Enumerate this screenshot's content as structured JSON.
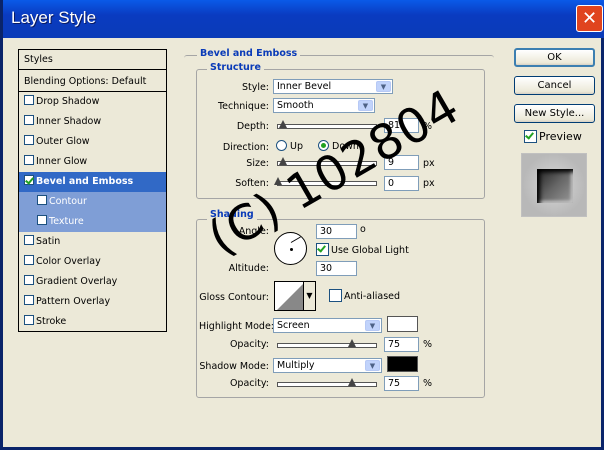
{
  "window": {
    "title": "Layer Style",
    "close_label": "✕"
  },
  "styles_panel": {
    "header": "Styles",
    "items": [
      {
        "label": "Blending Options: Default",
        "checkbox": false
      },
      {
        "label": "Drop Shadow",
        "checkbox": true,
        "checked": false
      },
      {
        "label": "Inner Shadow",
        "checkbox": true,
        "checked": false
      },
      {
        "label": "Outer Glow",
        "checkbox": true,
        "checked": false
      },
      {
        "label": "Inner Glow",
        "checkbox": true,
        "checked": false
      },
      {
        "label": "Bevel and Emboss",
        "checkbox": true,
        "checked": true,
        "selected": true
      },
      {
        "label": "Contour",
        "checkbox": true,
        "checked": false,
        "sub": true
      },
      {
        "label": "Texture",
        "checkbox": true,
        "checked": false,
        "sub": true
      },
      {
        "label": "Satin",
        "checkbox": true,
        "checked": false
      },
      {
        "label": "Color Overlay",
        "checkbox": true,
        "checked": false
      },
      {
        "label": "Gradient Overlay",
        "checkbox": true,
        "checked": false
      },
      {
        "label": "Pattern Overlay",
        "checkbox": true,
        "checked": false
      },
      {
        "label": "Stroke",
        "checkbox": true,
        "checked": false
      }
    ]
  },
  "bevel": {
    "section_title": "Bevel and Emboss",
    "structure_title": "Structure",
    "style_label": "Style:",
    "style_value": "Inner Bevel",
    "technique_label": "Technique:",
    "technique_value": "Smooth",
    "depth_label": "Depth:",
    "depth_value": "81",
    "depth_unit": "%",
    "depth_level": 0.05,
    "direction_label": "Direction:",
    "dir_up": "Up",
    "dir_down": "Down",
    "direction_selected": "Down",
    "size_label": "Size:",
    "size_value": "9",
    "size_unit": "px",
    "size_level": 0.05,
    "soften_label": "Soften:",
    "soften_value": "0",
    "soften_unit": "px",
    "soften_level": 0.0
  },
  "shading": {
    "title": "Shading",
    "angle_label": "Angle:",
    "angle_value": "30",
    "angle_unit": "o",
    "use_global_label": "Use Global Light",
    "use_global_checked": true,
    "altitude_label": "Altitude:",
    "altitude_value": "30",
    "gloss_label": "Gloss Contour:",
    "anti_aliased_label": "Anti-aliased",
    "anti_aliased_checked": false,
    "highlight_mode_label": "Highlight Mode:",
    "highlight_mode_value": "Screen",
    "highlight_color": "#ffffff",
    "highlight_opacity_label": "Opacity:",
    "highlight_opacity_value": "75",
    "highlight_opacity_unit": "%",
    "highlight_opacity_level": 0.75,
    "shadow_mode_label": "Shadow Mode:",
    "shadow_mode_value": "Multiply",
    "shadow_color": "#000000",
    "shadow_opacity_label": "Opacity:",
    "shadow_opacity_value": "75",
    "shadow_opacity_unit": "%",
    "shadow_opacity_level": 0.75
  },
  "buttons": {
    "ok": "OK",
    "cancel": "Cancel",
    "new_style": "New Style...",
    "preview_label": "Preview",
    "preview_checked": true
  },
  "watermark": "(C) 102804"
}
